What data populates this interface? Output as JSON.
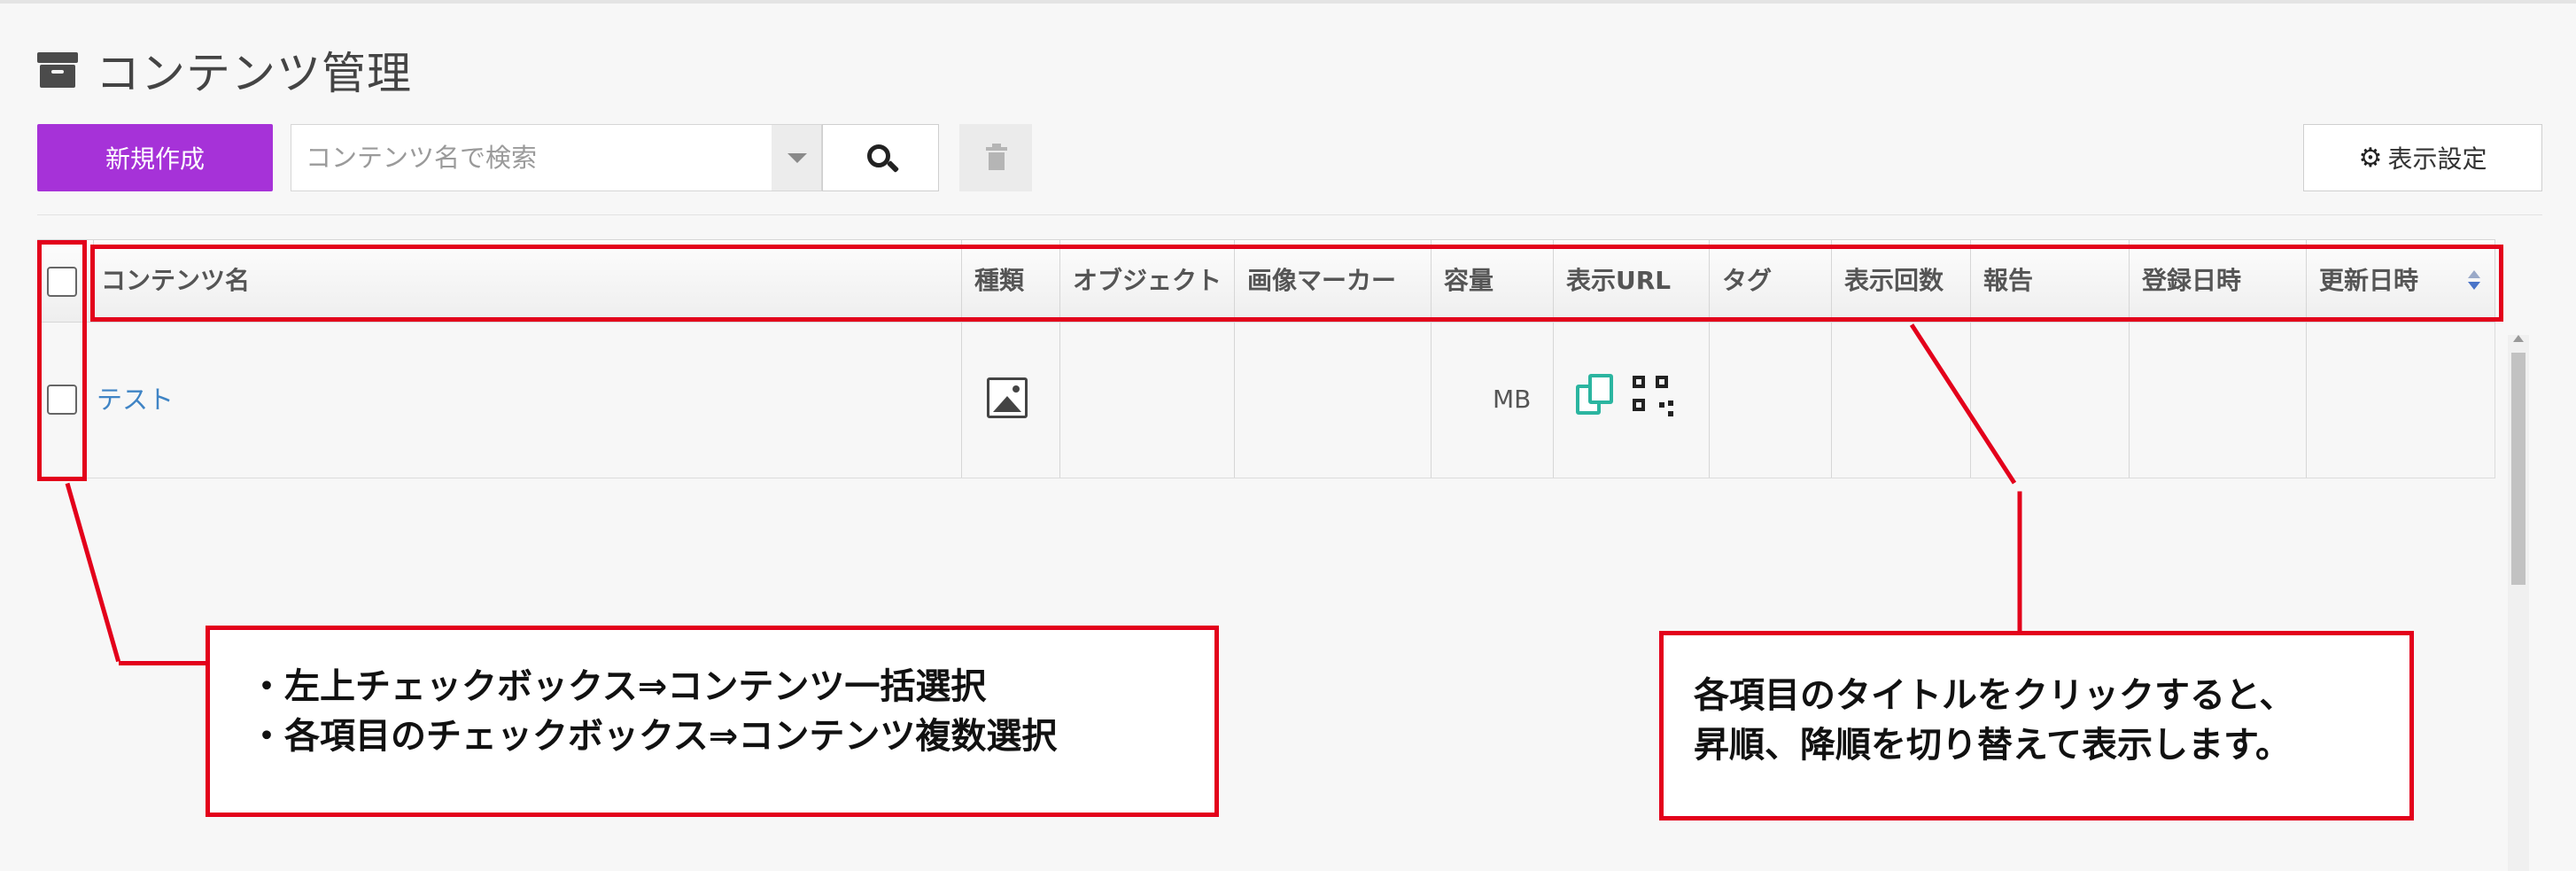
{
  "page": {
    "title": "コンテンツ管理"
  },
  "toolbar": {
    "new_label": "新規作成",
    "search_placeholder": "コンテンツ名で検索",
    "settings_label": "表示設定"
  },
  "table": {
    "columns": [
      "コンテンツ名",
      "種類",
      "オブジェクト",
      "画像マーカー",
      "容量",
      "表示URL",
      "タグ",
      "表示回数",
      "報告",
      "登録日時",
      "更新日時"
    ],
    "rows": [
      {
        "name": "テスト",
        "type_icon": "image-icon",
        "object": "",
        "image_marker": "",
        "size": "MB",
        "url_icons": [
          "copy-icon",
          "qr-code-icon"
        ],
        "tag": "",
        "views": "",
        "report": "",
        "registered_at": "",
        "updated_at": ""
      }
    ]
  },
  "annotations": {
    "checkbox_callout": [
      "・左上チェックボックス⇒コンテンツ一括選択",
      "・各項目のチェックボックス⇒コンテンツ複数選択"
    ],
    "header_callout": [
      "各項目のタイトルをクリックすると、",
      "昇順、降順を切り替えて表示します。"
    ],
    "highlight_color": "#e3001b"
  },
  "colors": {
    "primary_button": "#a632d8",
    "link": "#3f84c5",
    "copy_icon": "#2bb5a0"
  }
}
